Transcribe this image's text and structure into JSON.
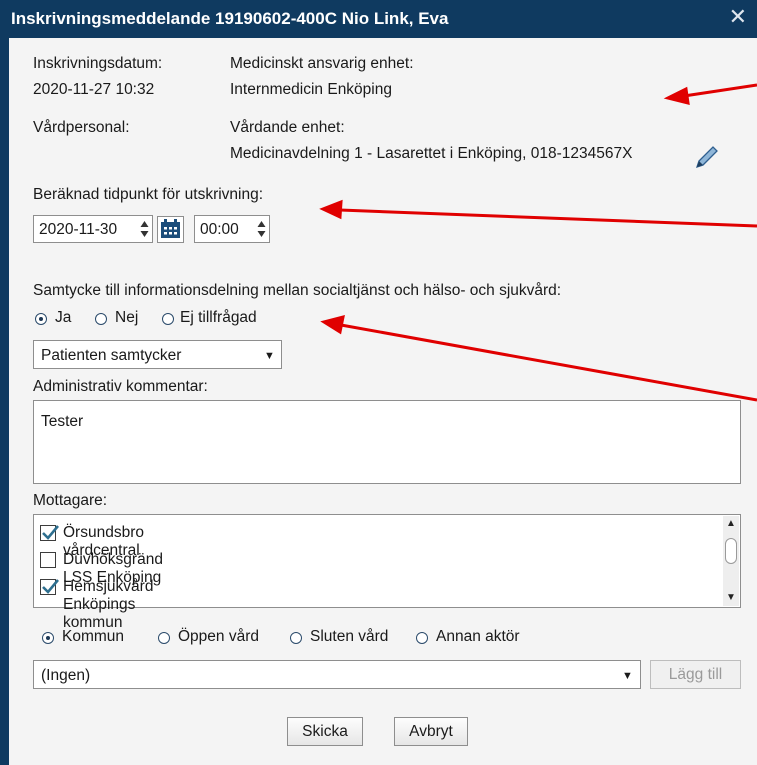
{
  "window": {
    "title": "Inskrivningsmeddelande 19190602-400C Nio Link, Eva",
    "close_glyph": "✕"
  },
  "info": {
    "admission_date_label": "Inskrivningsdatum:",
    "admission_date_value": "2020-11-27 10:32",
    "responsible_unit_label": "Medicinskt ansvarig enhet:",
    "responsible_unit_value": "Internmedicin Enköping",
    "care_staff_label": "Vårdpersonal:",
    "care_unit_label": "Vårdande enhet:",
    "care_unit_value": "Medicinavdelning 1 - Lasarettet i Enköping, 018-1234567X",
    "edit_icon": "pencil-icon"
  },
  "discharge": {
    "label": "Beräknad tidpunkt för utskrivning:",
    "date_value": "2020-11-30",
    "time_value": "00:00",
    "calendar_icon": "calendar-icon"
  },
  "consent": {
    "label": "Samtycke till informationsdelning mellan socialtjänst och hälso- och sjukvård:",
    "options": [
      "Ja",
      "Nej",
      "Ej tillfrågad"
    ],
    "selected": "Ja",
    "dropdown_value": "Patienten samtycker"
  },
  "comment": {
    "label": "Administrativ kommentar:",
    "value": "Tester"
  },
  "recipients": {
    "label": "Mottagare:",
    "items": [
      {
        "name": "Örsundsbro vårdcentral",
        "checked": true
      },
      {
        "name": "Duvhöksgränd LSS Enköping",
        "checked": false
      },
      {
        "name": "Hemsjukvård Enköpings kommun",
        "checked": true
      }
    ]
  },
  "recipient_type": {
    "options": [
      "Kommun",
      "Öppen vård",
      "Sluten vård",
      "Annan aktör"
    ],
    "selected": "Kommun",
    "dropdown_value": "(Ingen)",
    "add_button": "Lägg till"
  },
  "actions": {
    "send": "Skicka",
    "cancel": "Avbryt"
  },
  "colors": {
    "titlebar": "#0f3a60",
    "dialog_bg": "#f4f4f4",
    "annotation_arrow": "#e00000",
    "checkmark": "#2e6f8f"
  }
}
